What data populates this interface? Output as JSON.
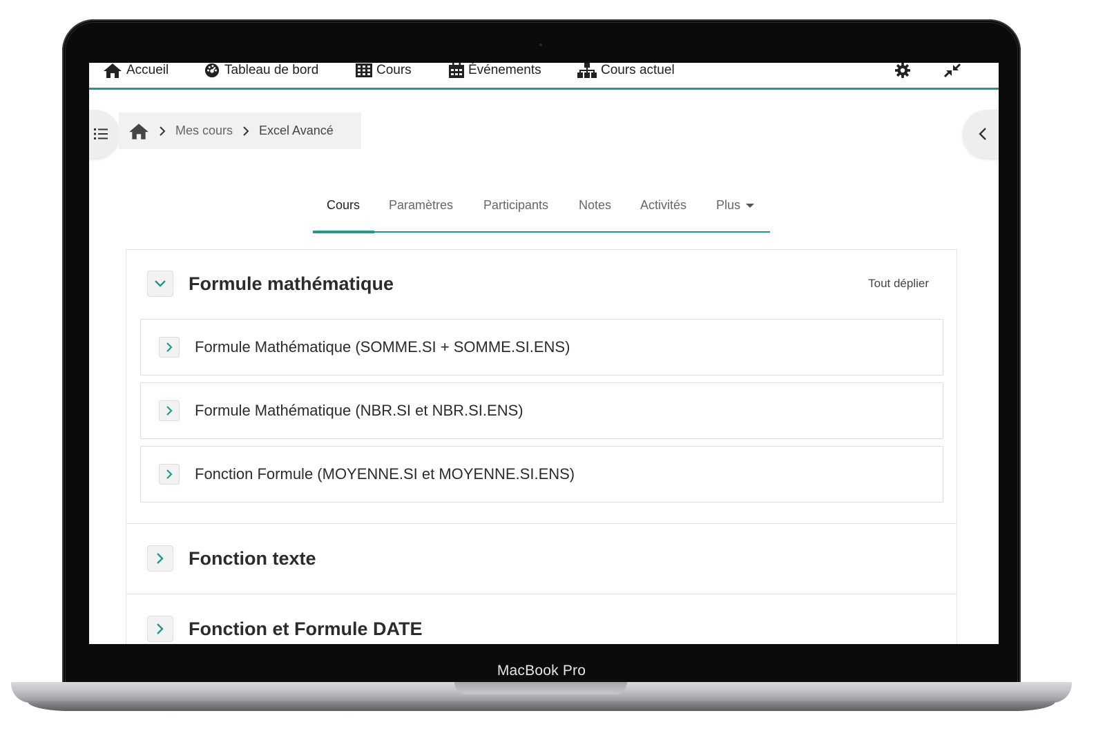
{
  "device": {
    "label": "MacBook Pro"
  },
  "topnav": {
    "items": [
      {
        "label": "Accueil",
        "icon": "home-icon"
      },
      {
        "label": "Tableau de bord",
        "icon": "dashboard-icon"
      },
      {
        "label": "Cours",
        "icon": "grid-icon"
      },
      {
        "label": "Événements",
        "icon": "calendar-icon"
      },
      {
        "label": "Cours actuel",
        "icon": "sitemap-icon"
      }
    ],
    "right_icons": [
      "gear-icon",
      "compress-icon"
    ]
  },
  "breadcrumb": {
    "items": [
      "Mes cours",
      "Excel Avancé"
    ]
  },
  "tabs": [
    {
      "label": "Cours",
      "active": true
    },
    {
      "label": "Paramètres"
    },
    {
      "label": "Participants"
    },
    {
      "label": "Notes"
    },
    {
      "label": "Activités"
    },
    {
      "label": "Plus"
    }
  ],
  "course": {
    "expand_all_label": "Tout déplier",
    "sections": [
      {
        "title": "Formule mathématique",
        "expanded": true,
        "subsections": [
          "Formule Mathématique (SOMME.SI + SOMME.SI.ENS)",
          "Formule Mathématique (NBR.SI et NBR.SI.ENS)",
          "Fonction Formule (MOYENNE.SI et MOYENNE.SI.ENS)"
        ]
      },
      {
        "title": "Fonction texte",
        "expanded": false
      },
      {
        "title": "Fonction et Formule DATE",
        "expanded": false
      }
    ]
  },
  "colors": {
    "accent": "#1e9a8a",
    "text": "#2b2b2b",
    "muted": "#666666"
  }
}
